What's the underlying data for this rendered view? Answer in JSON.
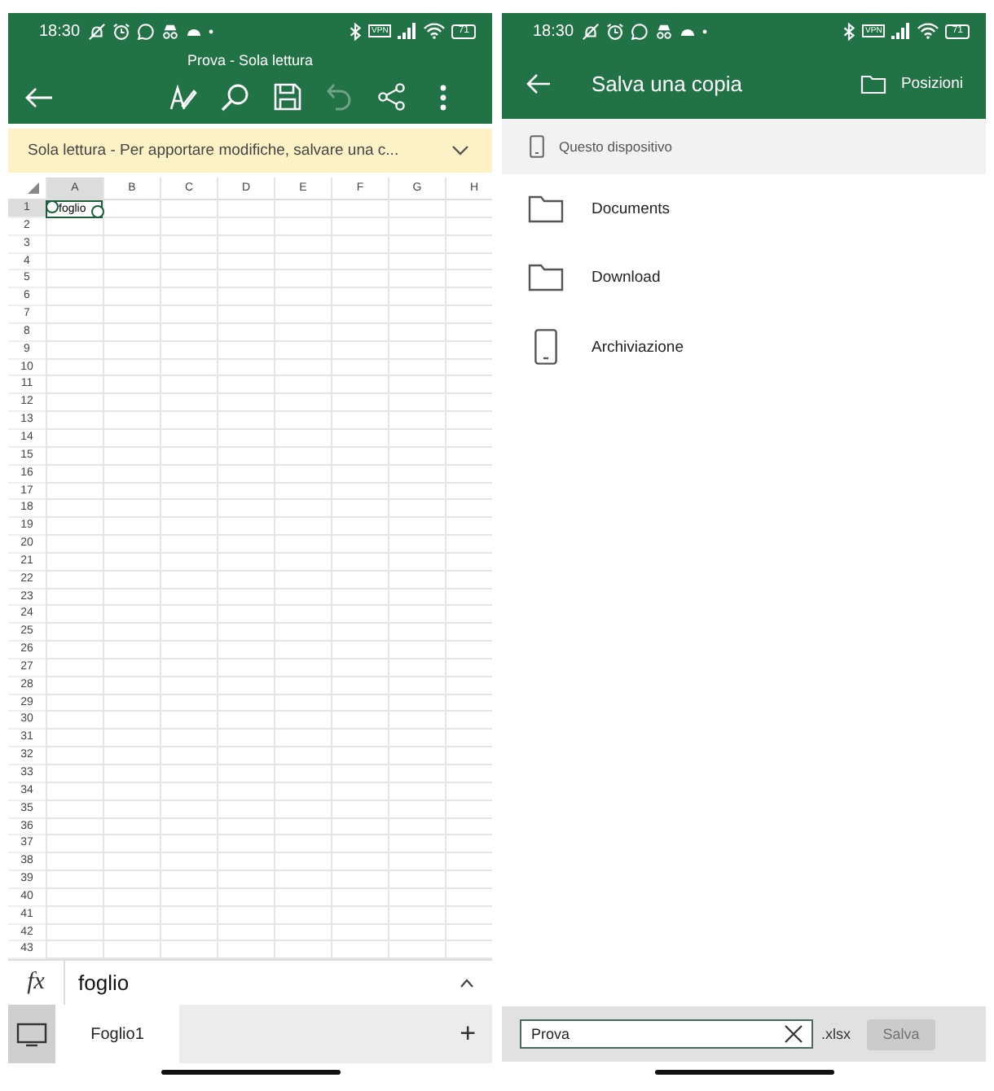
{
  "left_screen": {
    "status_bar": {
      "time": "18:30",
      "vpn": "VPN",
      "battery": "71"
    },
    "document_title": "Prova - Sola lettura",
    "toolbar": [
      {
        "kind": "back",
        "disabled": false
      },
      {
        "kind": "draw",
        "disabled": false
      },
      {
        "kind": "search",
        "disabled": false
      },
      {
        "kind": "save",
        "disabled": false
      },
      {
        "kind": "undo",
        "disabled": true
      },
      {
        "kind": "share",
        "disabled": false
      },
      {
        "kind": "more",
        "disabled": false
      }
    ],
    "banner": {
      "text": "Sola lettura - Per apportare modifiche, salvare una c...",
      "expanded": false
    },
    "grid": {
      "columns": [
        {
          "label": "A",
          "selected": true
        },
        {
          "label": "B",
          "selected": false
        },
        {
          "label": "C",
          "selected": false
        },
        {
          "label": "D",
          "selected": false
        },
        {
          "label": "E",
          "selected": false
        },
        {
          "label": "F",
          "selected": false
        },
        {
          "label": "G",
          "selected": false
        },
        {
          "label": "H",
          "selected": false
        }
      ],
      "rows": [
        {
          "label": "1",
          "selected": true,
          "cells": [
            "foglio"
          ]
        },
        {
          "label": "2",
          "selected": false
        },
        {
          "label": "3",
          "selected": false
        },
        {
          "label": "4",
          "selected": false
        },
        {
          "label": "5",
          "selected": false
        },
        {
          "label": "6",
          "selected": false
        },
        {
          "label": "7",
          "selected": false
        },
        {
          "label": "8",
          "selected": false
        },
        {
          "label": "9",
          "selected": false
        },
        {
          "label": "10",
          "selected": false
        },
        {
          "label": "11",
          "selected": false
        },
        {
          "label": "12",
          "selected": false
        },
        {
          "label": "13",
          "selected": false
        },
        {
          "label": "14",
          "selected": false
        },
        {
          "label": "15",
          "selected": false
        },
        {
          "label": "16",
          "selected": false
        },
        {
          "label": "17",
          "selected": false
        },
        {
          "label": "18",
          "selected": false
        },
        {
          "label": "19",
          "selected": false
        },
        {
          "label": "20",
          "selected": false
        },
        {
          "label": "21",
          "selected": false
        },
        {
          "label": "22",
          "selected": false
        },
        {
          "label": "23",
          "selected": false
        },
        {
          "label": "24",
          "selected": false
        },
        {
          "label": "25",
          "selected": false
        },
        {
          "label": "26",
          "selected": false
        },
        {
          "label": "27",
          "selected": false
        },
        {
          "label": "28",
          "selected": false
        },
        {
          "label": "29",
          "selected": false
        },
        {
          "label": "30",
          "selected": false
        },
        {
          "label": "31",
          "selected": false
        },
        {
          "label": "32",
          "selected": false
        },
        {
          "label": "33",
          "selected": false
        },
        {
          "label": "34",
          "selected": false
        },
        {
          "label": "35",
          "selected": false
        },
        {
          "label": "36",
          "selected": false
        },
        {
          "label": "37",
          "selected": false
        },
        {
          "label": "38",
          "selected": false
        },
        {
          "label": "39",
          "selected": false
        },
        {
          "label": "40",
          "selected": false
        },
        {
          "label": "41",
          "selected": false
        },
        {
          "label": "42",
          "selected": false
        },
        {
          "label": "43",
          "selected": false
        }
      ]
    },
    "formula_bar": {
      "label": "fx",
      "value": "foglio",
      "expanded": false
    },
    "sheet_tabs": [
      {
        "label": "Foglio1",
        "selected": true
      }
    ],
    "add_sheet": "+"
  },
  "right_screen": {
    "status_bar": {
      "time": "18:30",
      "vpn": "VPN",
      "battery": "71"
    },
    "title": "Salva una copia",
    "locations_button": "Posizioni",
    "current_location": "Questo dispositivo",
    "items": [
      {
        "label": "Documents",
        "kind": "folder"
      },
      {
        "label": "Download",
        "kind": "folder"
      },
      {
        "label": "Archiviazione",
        "kind": "device"
      }
    ],
    "save_bar": {
      "file_name": "Prova",
      "extension": ".xlsx",
      "save_button": {
        "label": "Salva",
        "disabled": true
      }
    }
  }
}
